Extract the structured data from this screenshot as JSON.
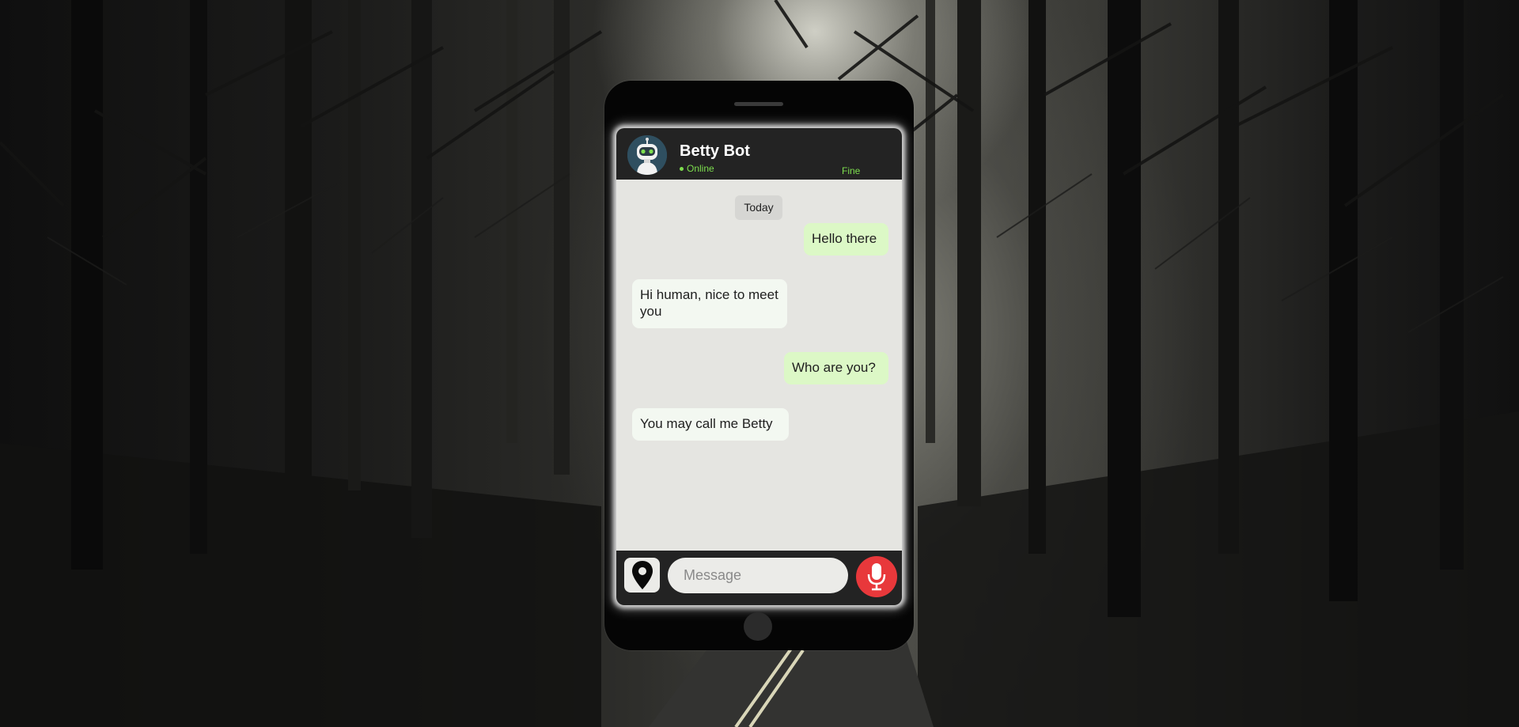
{
  "contact": {
    "name": "Betty Bot",
    "status": "Online",
    "mood": "Fine"
  },
  "chat": {
    "date_label": "Today",
    "messages": [
      {
        "direction": "sent",
        "text": "Hello there"
      },
      {
        "direction": "received",
        "text": "Hi human, nice to meet you"
      },
      {
        "direction": "sent",
        "text": "Who are you?"
      },
      {
        "direction": "received",
        "text": "You may call me Betty"
      }
    ]
  },
  "composer": {
    "placeholder": "Message",
    "location_icon": "map-pin-icon",
    "mic_icon": "microphone-icon"
  },
  "colors": {
    "header_bg": "#232323",
    "online_green": "#7dde4e",
    "sent_bubble": "#dcf8c6",
    "received_bubble": "#f3f8f1",
    "mic_red": "#e8383b"
  }
}
